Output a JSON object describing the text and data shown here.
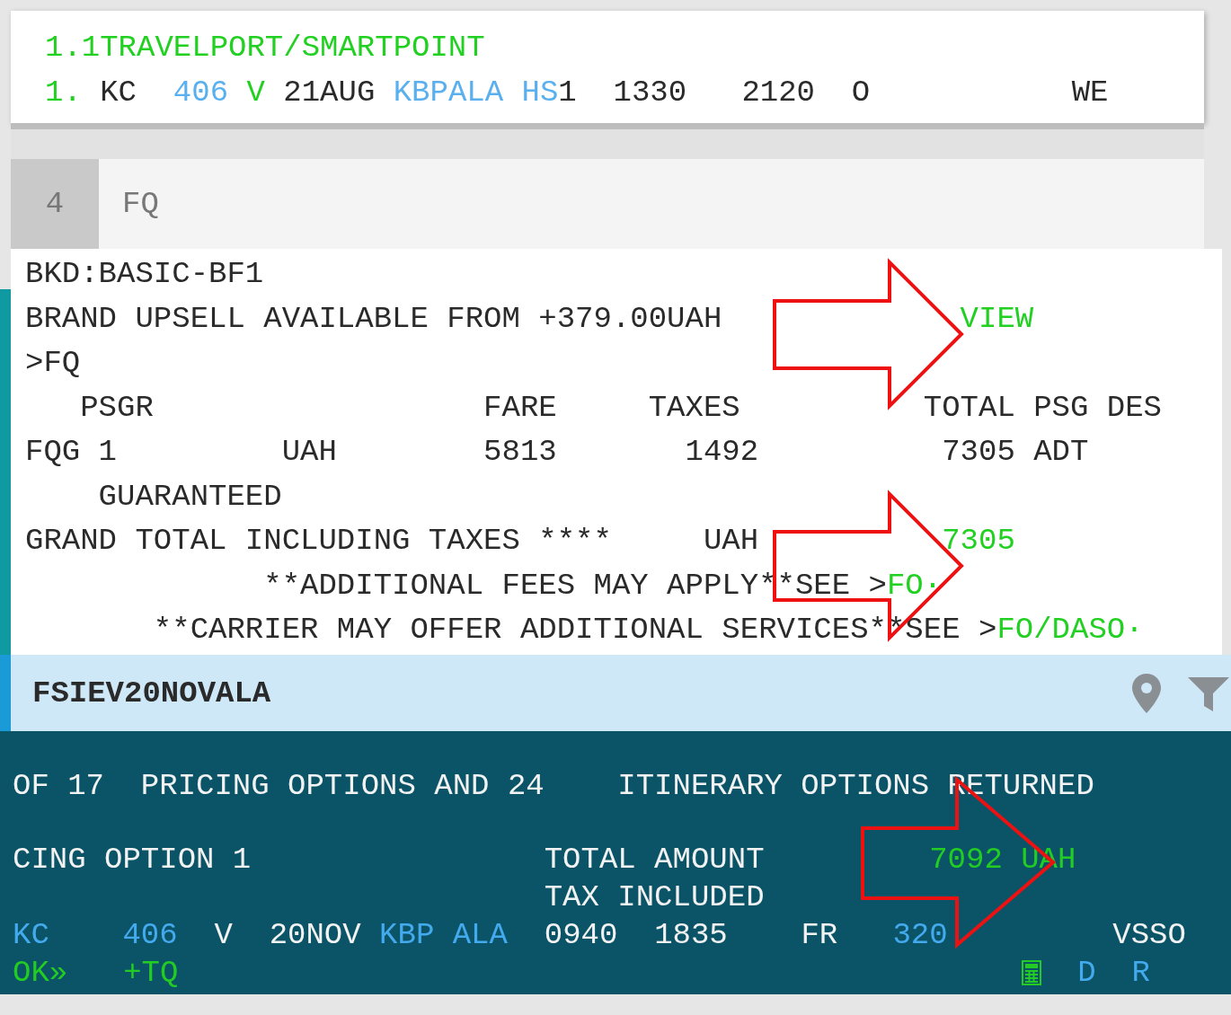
{
  "top_panel": {
    "lines": [
      [
        {
          "text": "1.1TRAVELPORT/SMARTPOINT",
          "color": "#22d022"
        }
      ],
      [
        {
          "text": "1.",
          "color": "#22d022"
        },
        {
          "text": " KC  ",
          "color": "#2a2a2a"
        },
        {
          "text": "406",
          "color": "#5ab0ee"
        },
        {
          "text": " V",
          "color": "#22d022"
        },
        {
          "text": " 21AUG ",
          "color": "#2a2a2a"
        },
        {
          "text": "KBPALA HS",
          "color": "#5ab0ee"
        },
        {
          "text": "1  1330   2120  O           WE",
          "color": "#2a2a2a"
        }
      ]
    ]
  },
  "command": {
    "number": "4",
    "text": "FQ"
  },
  "response": {
    "lines": [
      [
        {
          "text": "BKD:BASIC-BF1",
          "color": "#2a2a2a"
        }
      ],
      [
        {
          "text": "BRAND UPSELL AVAILABLE FROM +379.00UAH",
          "color": "#2a2a2a"
        },
        {
          "text": "             VIEW",
          "color": "#22d022"
        }
      ],
      [
        {
          "text": ">FQ",
          "color": "#2a2a2a"
        }
      ],
      [
        {
          "text": "   PSGR                  FARE     TAXES          TOTAL PSG DES",
          "color": "#2a2a2a"
        }
      ],
      [
        {
          "text": "FQG 1         UAH        5813       1492          7305 ADT",
          "color": "#2a2a2a"
        }
      ],
      [
        {
          "text": "    GUARANTEED",
          "color": "#2a2a2a"
        }
      ],
      [
        {
          "text": "GRAND TOTAL INCLUDING TAXES ****     UAH",
          "color": "#2a2a2a"
        },
        {
          "text": "          7305",
          "color": "#22d022"
        }
      ],
      [
        {
          "text": "             **ADDITIONAL FEES MAY APPLY**SEE >",
          "color": "#2a2a2a"
        },
        {
          "text": "FO·",
          "color": "#22d022"
        }
      ],
      [
        {
          "text": "       **CARRIER MAY OFFER ADDITIONAL SERVICES**SEE >",
          "color": "#2a2a2a"
        },
        {
          "text": "FO/DASO·",
          "color": "#22d022"
        }
      ]
    ]
  },
  "search_bar": {
    "query": "FSIEV20NOVALA"
  },
  "results": {
    "lines": [
      [
        {
          "text": "OF 17  PRICING OPTIONS AND 24    ITINERARY OPTIONS RETURNED",
          "color": "#f2f2f2"
        }
      ],
      [
        {
          "text": "CING OPTION 1                TOTAL AMOUNT",
          "color": "#f2f2f2"
        },
        {
          "text": "         7092 UAH",
          "color": "#22cc22"
        }
      ],
      [
        {
          "text": "                             TAX INCLUDED",
          "color": "#f2f2f2"
        }
      ],
      [
        {
          "text": "KC",
          "color": "#44aaee"
        },
        {
          "text": "    406",
          "color": "#44aaee"
        },
        {
          "text": "  V  20NOV",
          "color": "#f2f2f2"
        },
        {
          "text": " KBP ALA",
          "color": "#44aaee"
        },
        {
          "text": "  0940  1835    FR",
          "color": "#f2f2f2"
        },
        {
          "text": "   320",
          "color": "#44aaee"
        },
        {
          "text": "         VSSO",
          "color": "#f2f2f2"
        }
      ]
    ],
    "footer": {
      "left": [
        {
          "text": "OK»"
        },
        {
          "text": "+TQ"
        }
      ],
      "right": [
        {
          "text": "D"
        },
        {
          "text": "R"
        }
      ]
    }
  }
}
